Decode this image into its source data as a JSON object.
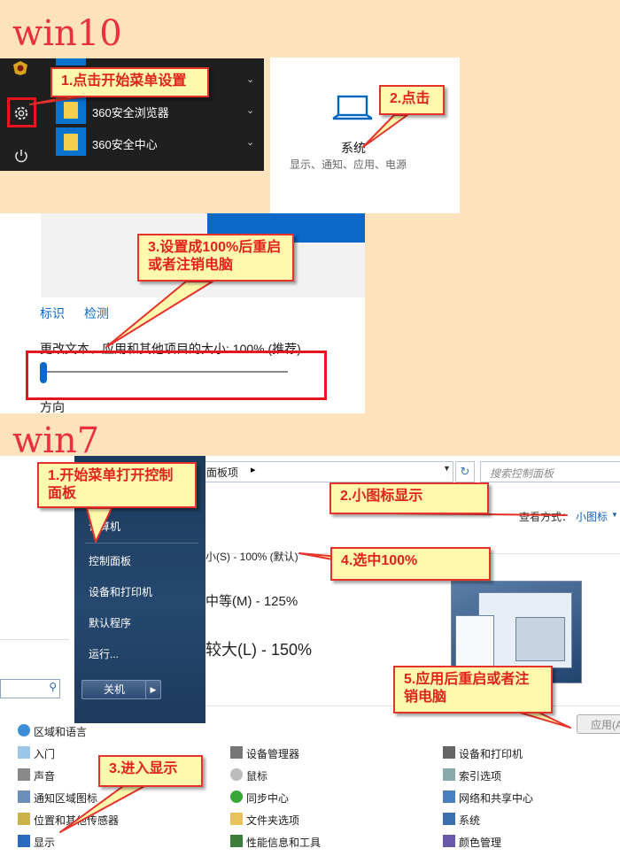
{
  "win10": {
    "title": "win10",
    "menu_items": [
      {
        "label": "360安全浏览器"
      },
      {
        "label": "360安全中心"
      }
    ],
    "settings_card": {
      "label": "系统",
      "sublabel": "显示、通知、应用、电源"
    },
    "display": {
      "links": [
        "标识",
        "检测"
      ],
      "scale_label": "更改文本、应用和其他项目的大小: 100% (推荐)",
      "scale_value_percent": 100,
      "orientation_label": "方向"
    },
    "callouts": [
      "1.点击开始菜单设置",
      "2.点击",
      "3.设置成100%后重启或者注销电脑"
    ]
  },
  "win7": {
    "title": "win7",
    "address_text": "面板项",
    "search_placeholder": "搜索控制面板",
    "view_by_label": "查看方式：",
    "view_by_value": "小图标",
    "start_menu": {
      "items": [
        "计算机",
        "控制面板",
        "设备和打印机",
        "默认程序",
        "运行..."
      ],
      "shutdown_label": "关机"
    },
    "size_options": [
      "小(S) - 100% (默认)",
      "中等(M) - 125%",
      "较大(L) - 150%"
    ],
    "apply_label": "应用(A)",
    "control_panel": [
      {
        "label": "区域和语言"
      },
      {
        "label": "入门"
      },
      {
        "label": "设备管理器"
      },
      {
        "label": "设备和打印机"
      },
      {
        "label": "声音"
      },
      {
        "label": "鼠标"
      },
      {
        "label": "索引选项"
      },
      {
        "label": "通知区域图标"
      },
      {
        "label": "同步中心"
      },
      {
        "label": "网络和共享中心"
      },
      {
        "label": "位置和其他传感器"
      },
      {
        "label": "文件夹选项"
      },
      {
        "label": "系统"
      },
      {
        "label": "显示"
      },
      {
        "label": "性能信息和工具"
      },
      {
        "label": "颜色管理"
      }
    ],
    "callouts": [
      "1.开始菜单打开控制面板",
      "2.小图标显示",
      "4.选中100%",
      "5.应用后重启或者注销电脑",
      "3.进入显示"
    ]
  }
}
